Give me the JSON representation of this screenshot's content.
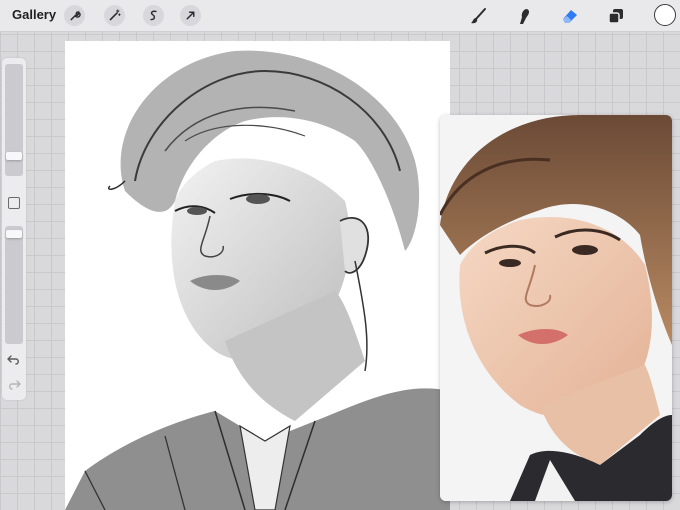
{
  "topbar": {
    "gallery_label": "Gallery",
    "left_tools": [
      {
        "name": "actions",
        "icon": "wrench-icon"
      },
      {
        "name": "adjustments",
        "icon": "magic-wand-icon"
      },
      {
        "name": "selection",
        "icon": "selection-s-icon"
      },
      {
        "name": "transform",
        "icon": "arrow-cursor-icon"
      }
    ],
    "right_tools": [
      {
        "name": "brush",
        "icon": "brush-icon"
      },
      {
        "name": "smudge",
        "icon": "smudge-finger-icon"
      },
      {
        "name": "eraser",
        "icon": "eraser-icon",
        "active": true,
        "color": "#2f7bf5"
      },
      {
        "name": "layers",
        "icon": "layers-icon"
      }
    ],
    "current_color": "#ffffff"
  },
  "sidebar": {
    "brush_size_icon": "brush-size-slider",
    "opacity_icon": "opacity-slider",
    "modify_icon": "square-modify-icon",
    "undo_icon": "undo-arrow-icon",
    "redo_icon": "redo-arrow-icon"
  },
  "canvas": {
    "background": "#ffffff",
    "content": "pencil-sketch-portrait"
  },
  "reference": {
    "content": "reference-photo-portrait"
  }
}
